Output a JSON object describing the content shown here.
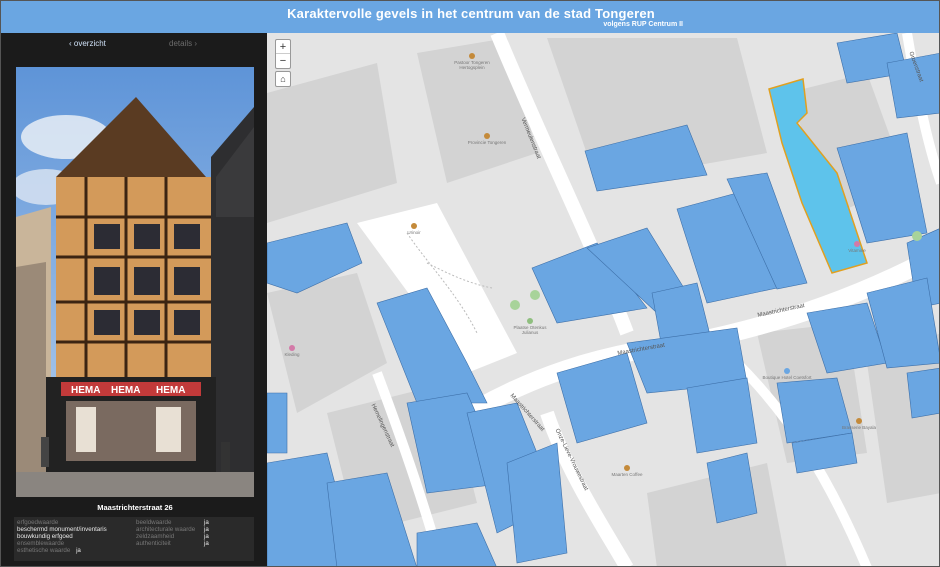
{
  "header": {
    "title": "Karaktervolle gevels in het centrum van de stad Tongeren",
    "subtitle": "volgens RUP Centrum II"
  },
  "nav": {
    "back_label": "‹ overzicht",
    "forward_label": "details ›"
  },
  "feature": {
    "address": "Maastrichterstraat 26",
    "attributes_left": [
      {
        "label": "erfgoedwaarde",
        "active": false
      },
      {
        "label": "beschermd monument/inventaris",
        "active": true
      },
      {
        "label": "bouwkundig erfgoed",
        "active": true
      },
      {
        "label": "ensemblewaarde",
        "active": false
      },
      {
        "label": "esthetische waarde",
        "active": false,
        "value": "ja"
      }
    ],
    "attributes_right": [
      {
        "label": "beeldwaarde",
        "value": "ja"
      },
      {
        "label": "architecturale waarde",
        "value": "ja"
      },
      {
        "label": "zeldzaamheid",
        "value": "ja"
      },
      {
        "label": "authenticiteit",
        "value": "ja"
      }
    ],
    "photo_signs": [
      "HEMA",
      "HEMA",
      "HEMA",
      "HEMA"
    ]
  },
  "map": {
    "zoom_in": "+",
    "zoom_out": "−",
    "home": "⌂",
    "streets": [
      {
        "name": "Vermeulenstraat"
      },
      {
        "name": "Maastrichterstraat"
      },
      {
        "name": "Maastrichterstraat"
      },
      {
        "name": "Maastrichterstraat"
      },
      {
        "name": "Onze-Lieve-Vrouwestraat"
      },
      {
        "name": "Hemelingenstraat"
      },
      {
        "name": "Groenstraat"
      }
    ],
    "pois": [
      {
        "name": "Pastoor Tongeren Hertogsplein"
      },
      {
        "name": "Provincie Tongeren"
      },
      {
        "name": "Urinoir"
      },
      {
        "name": "Plaatse Otenkus Julianus"
      },
      {
        "name": "Kleding"
      },
      {
        "name": "Maarten Coffee"
      },
      {
        "name": "Brasserie Bayala"
      },
      {
        "name": "Boutique Hotel Coetsfort"
      },
      {
        "name": "Vitamine"
      }
    ],
    "colors": {
      "heritage": "#6aa6e2",
      "selected": "#5ec3eb",
      "selected_outline": "#e0a020",
      "block": "#d3d3d3",
      "road": "#ffffff",
      "background": "#e4e4e4"
    }
  }
}
